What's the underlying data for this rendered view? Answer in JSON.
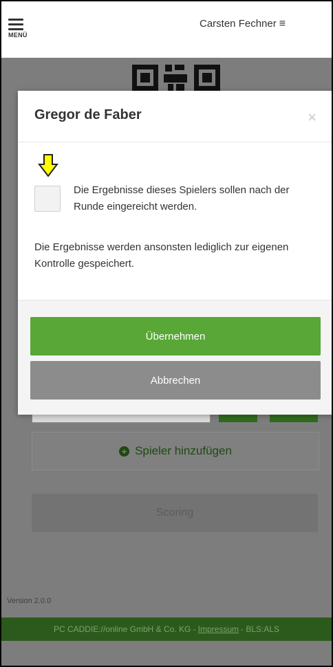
{
  "header": {
    "menu_label": "MENÜ",
    "user_name": "Carsten Fechner",
    "user_menu_icon": "≡"
  },
  "background": {
    "add_player_label": "Spieler hinzufügen",
    "scoring_label": "Scoring",
    "version": "Version 2.0.0",
    "footer": {
      "company": "PC CADDIE://online GmbH & Co. KG -",
      "impressum": "Impressum",
      "suffix": "- BLS:ALS"
    }
  },
  "modal": {
    "title": "Gregor de Faber",
    "close_glyph": "×",
    "checkbox_label": "Die Ergebnisse dieses Spielers sollen nach der Runde eingereicht werden.",
    "checkbox_checked": false,
    "note": "Die Ergebnisse werden ansonsten lediglich zur eigenen Kontrolle gespeichert.",
    "confirm_label": "Übernehmen",
    "cancel_label": "Abbrechen"
  },
  "colors": {
    "primary_green": "#58a737",
    "cancel_gray": "#8c8c8c",
    "arrow_yellow": "#ffff00"
  },
  "icons": [
    "menu-icon",
    "hamburger-icon",
    "qr-code-icon",
    "close-icon",
    "arrow-down-icon",
    "plus-circle-icon"
  ]
}
